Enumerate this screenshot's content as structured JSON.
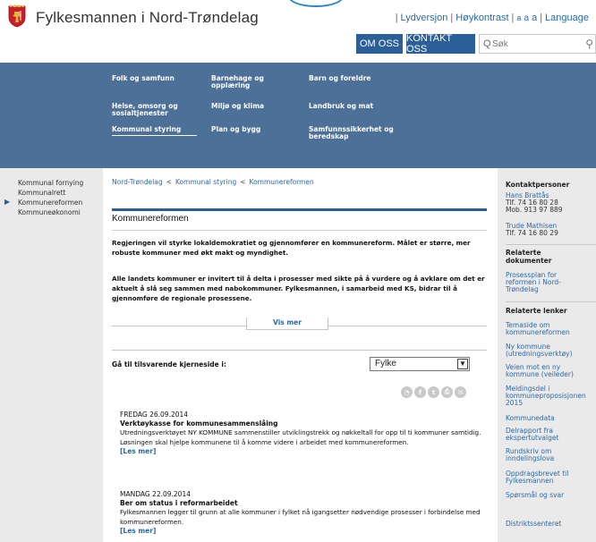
{
  "header": {
    "title": "Fylkesmannen i Nord-Trøndelag",
    "util_links": [
      "Lydversjon",
      "Høykontrast",
      "a",
      "a",
      "a",
      "Language"
    ],
    "btn_om_oss": "OM OSS",
    "btn_kontakt": "KONTAKT OSS",
    "search_placeholder": "Søk"
  },
  "mega_nav": [
    {
      "label": "Folk og samfunn"
    },
    {
      "label": "Barnehage og opplæring"
    },
    {
      "label": "Barn og foreldre"
    },
    {
      "label": "Helse, omsorg og sosialtjenester"
    },
    {
      "label": "Miljø og klima"
    },
    {
      "label": "Landbruk og mat"
    },
    {
      "label": "Kommunal styring",
      "active": true
    },
    {
      "label": "Plan og bygg"
    },
    {
      "label": "Samfunnssikkerhet og beredskap"
    }
  ],
  "left_nav": {
    "items": [
      {
        "label": "Kommunal fornying"
      },
      {
        "label": "Kommunalrett"
      },
      {
        "label": "Kommunereformen",
        "current": true
      },
      {
        "label": "Kommuneøkonomi"
      }
    ]
  },
  "breadcrumb": [
    "Nord-Trøndelag",
    "Kommunal styring",
    "Kommunereformen"
  ],
  "breadcrumb_sep": "<",
  "page_title": "Kommunereformen",
  "intro": [
    "Regjeringen vil styrke lokaldemokratiet og gjennomfører en kommunereform. Målet er større, mer robuste kommuner med økt makt og myndighet.",
    "Alle landets kommuner er invitert til å delta i prosesser med sikte på å vurdere og å avklare om det er aktuelt å slå seg sammen med nabokommuner. Fylkesmannen, i samarbeid med KS, bidrar til å gjennomføre de regionale prosessene."
  ],
  "vis_mer": "Vis mer",
  "goto_label": "Gå til tilsvarende kjerneside i:",
  "goto_select": "Fylke",
  "share_icons": [
    "rss-icon",
    "facebook-icon",
    "twitter-icon",
    "print-icon",
    "email-icon"
  ],
  "share_glyphs": [
    "◔",
    "f",
    "t",
    "⎙",
    "✉"
  ],
  "news": [
    {
      "date": "FREDAG 26.09.2014",
      "title": "Verktøykasse for kommunesammenslåing",
      "body": "Utredningsverktøyet NY KOMMUNE sammenstiller utviklingstrekk og nøkkeltall for opp til ti kommuner samtidig. Løsningen skal hjelpe kommunene til å komme videre i arbeidet med kommunereformen.",
      "more": "[Les mer]"
    },
    {
      "date": "MANDAG 22.09.2014",
      "title": "Ber om status i reformarbeidet",
      "body": "Fylkesmannen legger til grunn at alle kommuner i fylket nå igangsetter nødvendige prosesser i forbindelse med kommunereformen.",
      "more": "[Les mer]"
    }
  ],
  "right": {
    "kontakt_heading": "Kontaktpersoner",
    "contacts": [
      {
        "name": "Hans Brattås",
        "lines": [
          "Tlf. 74 16 80 28",
          "Mob. 913 97 889"
        ]
      },
      {
        "name": "Trude Mathisen",
        "lines": [
          "Tlf. 74 16 80 29"
        ]
      }
    ],
    "docs_heading": "Relaterte dokumenter",
    "docs": [
      "Prosessplan for reformen i Nord-Trøndelag"
    ],
    "links_heading": "Relaterte lenker",
    "links": [
      "Temaside om kommunereformen",
      "Ny kommune (utredningsverktøy)",
      "Veien mot en ny kommune (veileder)",
      "Meldingsdel i kommuneproposisjonen 2015",
      "Kommunedata",
      "Delrapport fra ekspertutvalget",
      "Rundskriv om inndelingslova",
      "Oppdragsbrevet til Fylkesmannen",
      "Spørsmål og svar",
      "Distriktssenteret"
    ]
  },
  "colors": {
    "brand_blue": "#2b5f98",
    "nav_band": "#4c7097",
    "link": "#2a6aa8",
    "sidebar_bg": "#eaeaea"
  }
}
